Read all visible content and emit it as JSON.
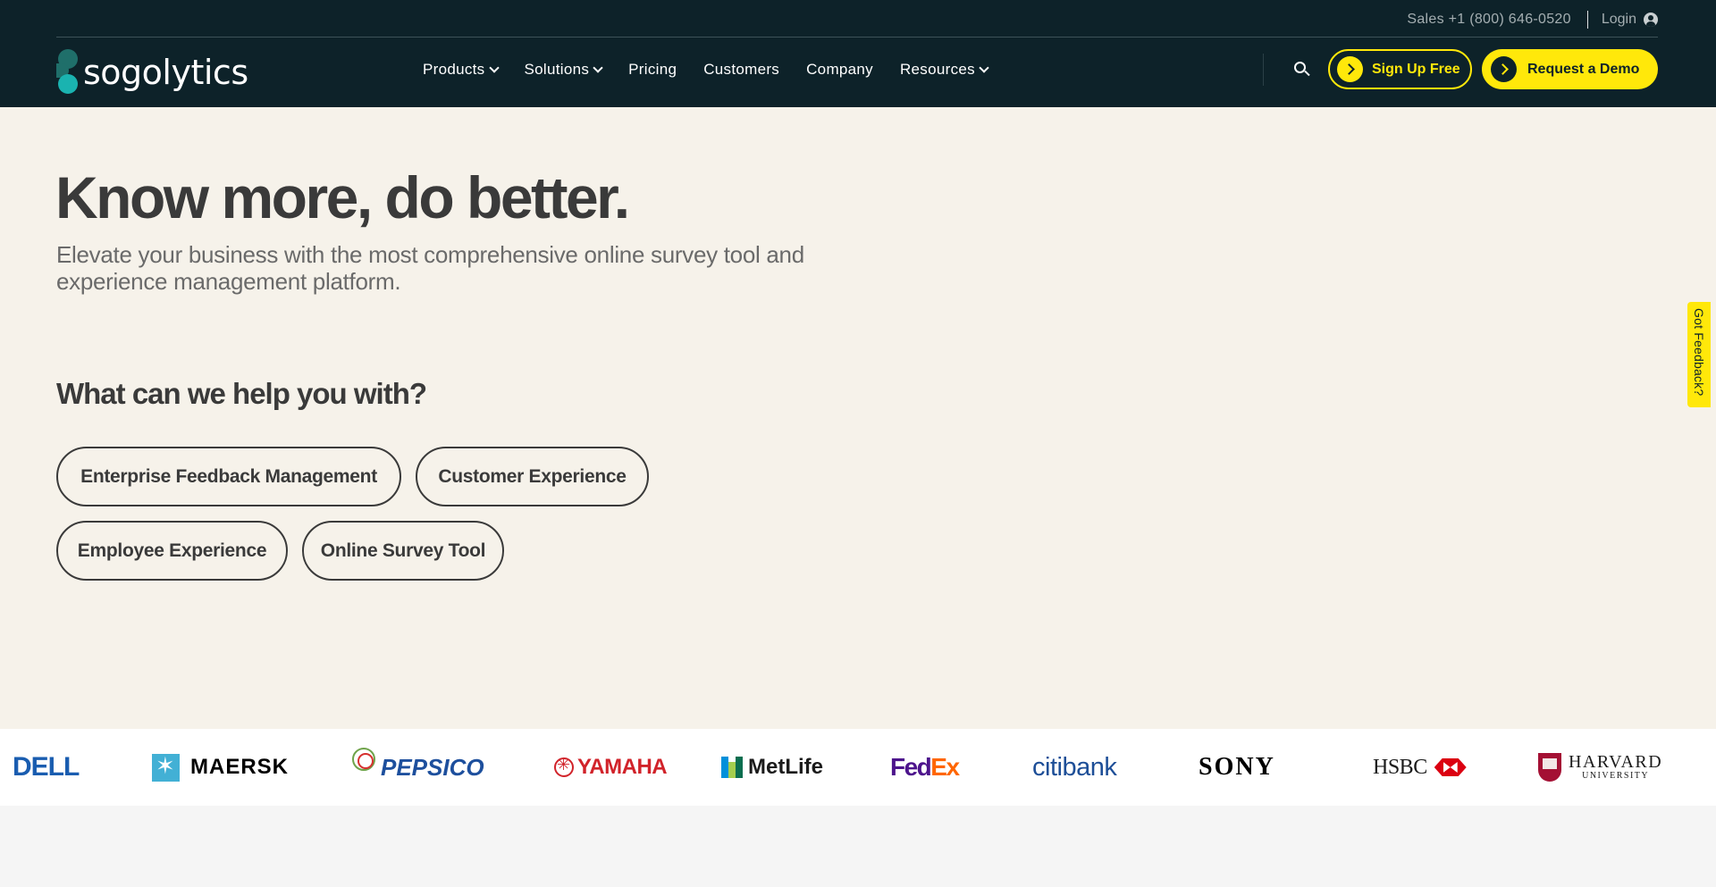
{
  "topbar": {
    "sales": "Sales +1 (800) 646-0520",
    "login": "Login",
    "login_icon": "user-circle-icon"
  },
  "brand": {
    "name": "sogolytics"
  },
  "nav": {
    "items": [
      {
        "label": "Products",
        "dropdown": true
      },
      {
        "label": "Solutions",
        "dropdown": true
      },
      {
        "label": "Pricing",
        "dropdown": false
      },
      {
        "label": "Customers",
        "dropdown": false
      },
      {
        "label": "Company",
        "dropdown": false
      },
      {
        "label": "Resources",
        "dropdown": true
      }
    ],
    "search_icon": "search-icon",
    "signup_label": "Sign Up Free",
    "demo_label": "Request a Demo"
  },
  "hero": {
    "title": "Know more, do better.",
    "subtitle": "Elevate your business with the most comprehensive online survey tool and experience management platform.",
    "help_title": "What can we help you with?",
    "options": [
      "Enterprise Feedback Management",
      "Customer Experience",
      "Employee Experience",
      "Online Survey Tool"
    ]
  },
  "feedback_tab": "Got Feedback?",
  "customer_logos": {
    "dell": "DELL",
    "maersk": "MAERSK",
    "pepsico": "PEPSICO",
    "yamaha": "YAMAHA",
    "metlife": "MetLife",
    "fedex_fed": "Fed",
    "fedex_ex": "Ex",
    "citibank": "citibank",
    "sony": "SONY",
    "hsbc": "HSBC",
    "harvard": "HARVARD",
    "harvard_sub": "UNIVERSITY"
  },
  "colors": {
    "header_bg": "#0d2229",
    "accent_yellow": "#ffe80a",
    "teal": "#1ab3b0",
    "page_bg": "#f6f2ea"
  }
}
